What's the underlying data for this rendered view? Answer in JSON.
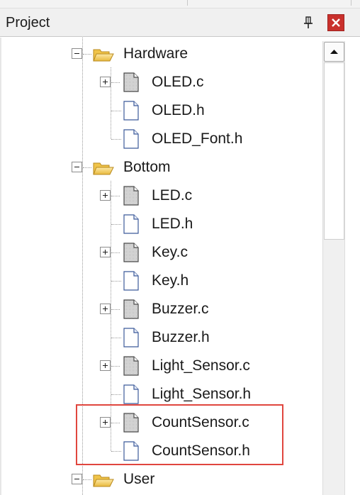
{
  "panel": {
    "title": "Project",
    "pin_icon": "pin-icon",
    "close_icon": "close-icon"
  },
  "tree": {
    "groups": [
      {
        "name": "Hardware",
        "icon": "folder-open-icon",
        "expanded": true
      },
      {
        "name": "Bottom",
        "icon": "folder-open-icon",
        "expanded": true
      },
      {
        "name": "User",
        "icon": "folder-open-icon",
        "expanded": true
      }
    ],
    "hardware_files": [
      {
        "name": "OLED.c",
        "type": "source",
        "expandable": true
      },
      {
        "name": "OLED.h",
        "type": "header",
        "expandable": false
      },
      {
        "name": "OLED_Font.h",
        "type": "header",
        "expandable": false
      }
    ],
    "bottom_files": [
      {
        "name": "LED.c",
        "type": "source",
        "expandable": true
      },
      {
        "name": "LED.h",
        "type": "header",
        "expandable": false
      },
      {
        "name": "Key.c",
        "type": "source",
        "expandable": true
      },
      {
        "name": "Key.h",
        "type": "header",
        "expandable": false
      },
      {
        "name": "Buzzer.c",
        "type": "source",
        "expandable": true
      },
      {
        "name": "Buzzer.h",
        "type": "header",
        "expandable": false
      },
      {
        "name": "Light_Sensor.c",
        "type": "source",
        "expandable": true
      },
      {
        "name": "Light_Sensor.h",
        "type": "header",
        "expandable": false
      },
      {
        "name": "CountSensor.c",
        "type": "source",
        "expandable": true
      },
      {
        "name": "CountSensor.h",
        "type": "header",
        "expandable": false
      }
    ]
  },
  "colors": {
    "highlight_box": "#e0463e",
    "close_button": "#c9302c",
    "folder": "#f2c94c"
  }
}
